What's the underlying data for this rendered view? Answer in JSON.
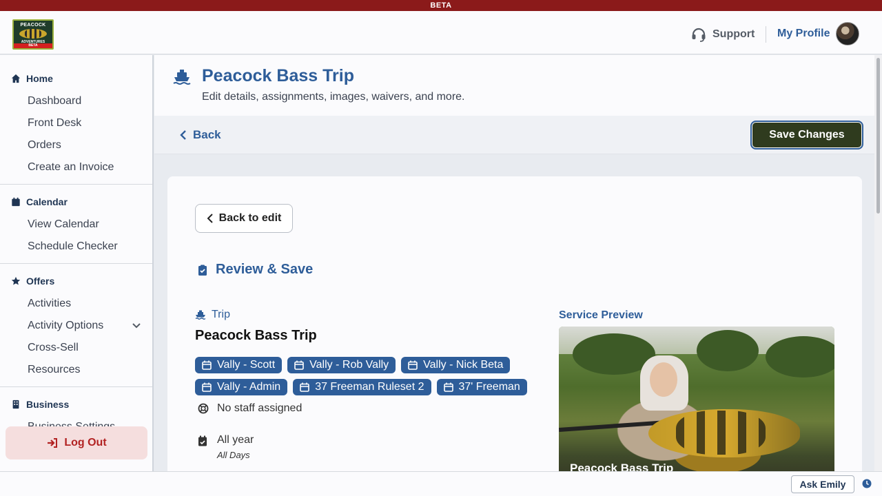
{
  "beta_banner": "BETA",
  "brand": {
    "logo_line1": "PEACOCK",
    "logo_line2": "ADVENTURES",
    "logo_line3": "BETA"
  },
  "topbar": {
    "support_label": "Support",
    "profile_label": "My Profile"
  },
  "sidebar": {
    "sections": [
      {
        "title": "Home",
        "icon": "home-icon",
        "items": [
          "Dashboard",
          "Front Desk",
          "Orders",
          "Create an Invoice"
        ]
      },
      {
        "title": "Calendar",
        "icon": "calendar-icon",
        "items": [
          "View Calendar",
          "Schedule Checker"
        ]
      },
      {
        "title": "Offers",
        "icon": "star-icon",
        "items": [
          "Activities",
          "Activity Options",
          "Cross-Sell",
          "Resources"
        ]
      },
      {
        "title": "Business",
        "icon": "building-icon",
        "items": [
          "Business Settings"
        ]
      }
    ],
    "logout_label": "Log Out"
  },
  "page": {
    "title": "Peacock Bass Trip",
    "subtitle": "Edit details, assignments, images, waivers, and more.",
    "back_label": "Back",
    "save_label": "Save Changes"
  },
  "review": {
    "back_to_edit_label": "Back to edit",
    "heading": "Review & Save",
    "trip_label": "Trip",
    "trip_name": "Peacock Bass Trip",
    "tags": [
      "Vally - Scott",
      "Vally - Rob Vally",
      "Vally - Nick Beta",
      "Vally - Admin",
      "37 Freeman Ruleset 2",
      "37' Freeman"
    ],
    "no_staff": "No staff assigned",
    "schedule_main": "All year",
    "schedule_sub": "All Days",
    "service_preview_label": "Service Preview",
    "preview_caption": "Peacock Bass Trip"
  },
  "footer": {
    "ask_label": "Ask Emily"
  },
  "colors": {
    "brand_blue": "#2e5d99",
    "save_green": "#2f3b1e",
    "beta_red": "#8b1a1a",
    "logout_red": "#b22222"
  }
}
